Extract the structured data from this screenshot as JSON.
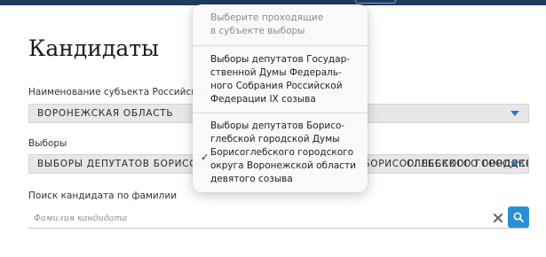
{
  "page": {
    "title": "Кандидаты"
  },
  "region": {
    "label": "Наименование субъекта Российской Федерации",
    "value": "ВОРОНЕЖСКАЯ ОБЛАСТЬ"
  },
  "elections": {
    "label": "Выборы",
    "value_left": "ВЫБОРЫ ДЕПУТАТОВ БОРИСОГЛЕБСКОЙ ГОРОДСКОЙ ДУМЫ БОРИСОГЛЕБСКОГО ГОРОДСКОГО О",
    "value_right": "ОГЛЕБСКОГО ГОРОДСКОГО О"
  },
  "search": {
    "label": "Поиск кандидата по фамилии",
    "placeholder": "Фамилия кандидата",
    "value": ""
  },
  "dropdown": {
    "header_line1": "Выберите проходящие",
    "header_line2": "в субъекте выборы",
    "options": [
      {
        "lines": [
          "Выборы депутатов Государ-",
          "ственной Думы Федераль-",
          "ного Собрания Российской",
          "Федерации IX созыва"
        ],
        "selected": false
      },
      {
        "lines": [
          "Выборы депутатов Борисо-",
          "глебской городской Думы",
          "Борисоглебского городского",
          "округа Воронежской области",
          "девятого созыва"
        ],
        "selected": true
      }
    ],
    "check_mark": "✓"
  },
  "icons": {
    "clear": "close-icon",
    "search": "search-icon",
    "select_arrow": "triangle-down-icon"
  },
  "colors": {
    "accent": "#2b8fd4",
    "arrow": "#2a78c9",
    "header_bar": "#1f3a63"
  }
}
